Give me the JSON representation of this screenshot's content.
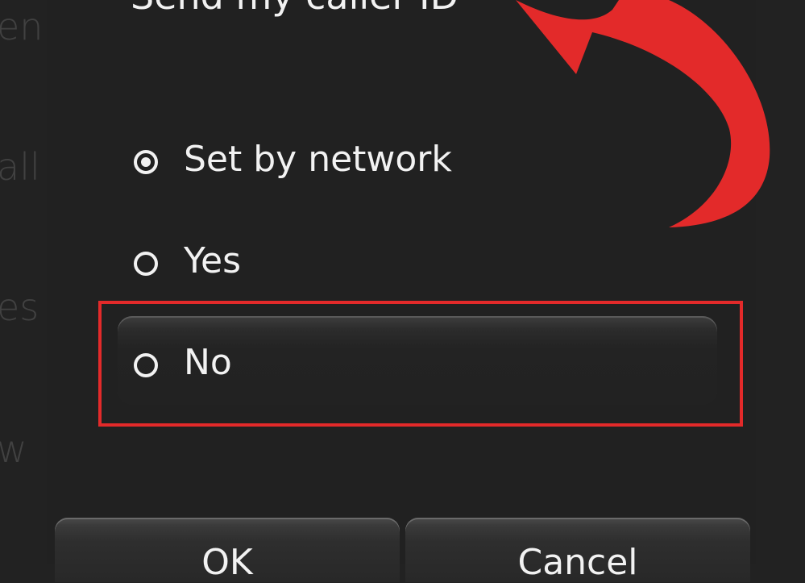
{
  "background_list": {
    "items": [
      "en",
      "all",
      "es",
      "w"
    ]
  },
  "dialog": {
    "title": "Send my caller ID",
    "options": [
      {
        "label": "Set by network",
        "selected": true
      },
      {
        "label": "Yes",
        "selected": false
      },
      {
        "label": "No",
        "selected": false
      }
    ],
    "highlighted_option": "No",
    "ok_label": "OK",
    "cancel_label": "Cancel"
  },
  "colors": {
    "background": "#222222",
    "text": "#f2f2f2",
    "annotation_red": "#e32a2a"
  },
  "icons": [
    "radio-selected-icon",
    "radio-unselected-icon",
    "annotation-arrow"
  ]
}
